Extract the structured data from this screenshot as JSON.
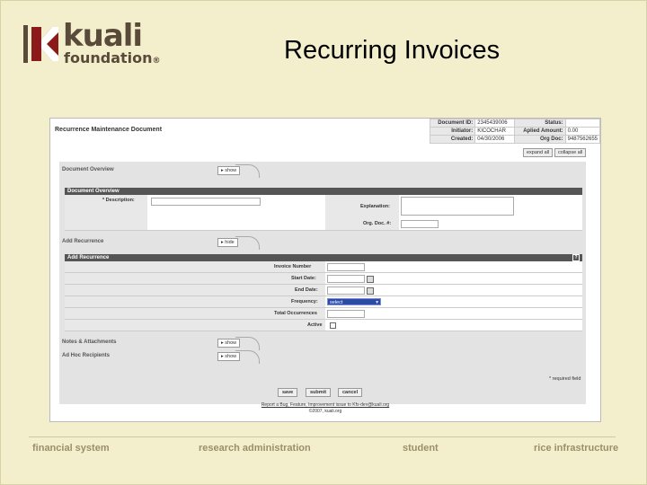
{
  "slide": {
    "title": "Recurring Invoices",
    "logo": {
      "word1": "kuali",
      "word2": "foundation",
      "reg": "®"
    },
    "footer": [
      "financial system",
      "research administration",
      "student",
      "rice infrastructure"
    ],
    "colors": {
      "background": "#f3efcc",
      "logo": "#5a4a3a",
      "logo_accent": "#8b1a1a"
    }
  },
  "document": {
    "title": "Recurrence Maintenance Document",
    "header": {
      "doc_id_label": "Document ID:",
      "doc_id": "2345439006",
      "status_label": "Status:",
      "status": "",
      "initiator_label": "Initiator:",
      "initiator": "KICOCHAR",
      "aplied_label": "Aplied Amount:",
      "aplied": "0.00",
      "created_label": "Created:",
      "created": "04/30/2006",
      "org_doc_label": "Org Doc:",
      "org_doc": "9487562655"
    },
    "expand_all": "expand all",
    "collapse_all": "collapse all"
  },
  "tabs": {
    "overview": {
      "label": "Document Overview",
      "btn": "show"
    },
    "add_recurrence": {
      "label": "Add Recurrence",
      "btn": "hide"
    },
    "notes": {
      "label": "Notes & Attachments",
      "btn": "show"
    },
    "adhoc": {
      "label": "Ad Hoc Recipients",
      "btn": "show"
    }
  },
  "overview_section": {
    "head": "Document Overview",
    "description_label": "* Description:",
    "explanation_label": "Explanation:",
    "org_doc_label": "Org. Doc. #:"
  },
  "recurrence_section": {
    "head": "Add Recurrence",
    "help": "?",
    "invoice_number_label": "Invoice Number",
    "start_date_label": "Start Date:",
    "end_date_label": "End Date:",
    "frequency_label": "Frequency:",
    "frequency_value": "select",
    "total_occurrences_label": "Total Occurrences",
    "active_label": "Active"
  },
  "actions": {
    "required_note": "* required field",
    "save": "save",
    "submit": "submit",
    "cancel": "cancel",
    "footer1": "Report a Bug, Feature, Improvement issue to Kfs-dev@kuali.org",
    "footer2": "©2007, kuali.org"
  }
}
